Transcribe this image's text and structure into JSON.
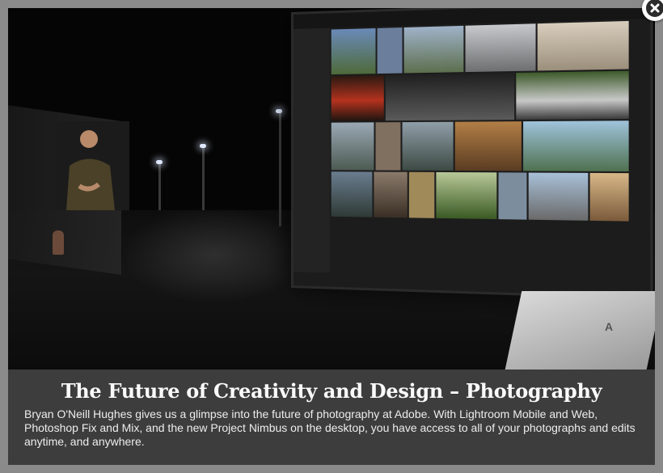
{
  "lightbox": {
    "title": "The Future of Creativity and Design – Photography",
    "description": "Bryan O'Neill Hughes gives us a glimpse into the future of photography at Adobe. With Lightroom Mobile and Web, Photoshop Fix and Mix, and the new Project Nimbus on the desktop, you have access to all of your photographs and edits anytime, and anywhere.",
    "close_icon": "close-icon"
  },
  "colors": {
    "backdrop": "#8a8a8a",
    "caption_bg": "#3d3d3d",
    "close_bg": "#ffffff"
  }
}
